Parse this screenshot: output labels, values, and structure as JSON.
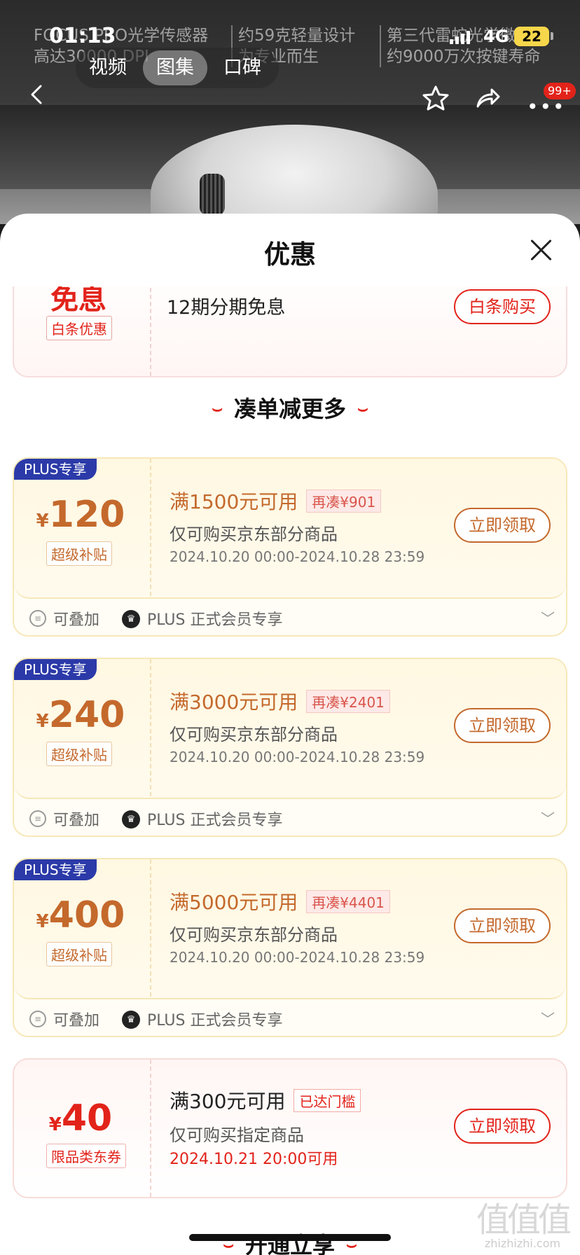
{
  "status_bar": {
    "time": "01:13",
    "network": "4G",
    "battery": "22"
  },
  "background_features": [
    {
      "line1": "FOCUS PRO光学传感器",
      "line2": "高达30000 DPI"
    },
    {
      "line1": "约59克轻量设计",
      "line2": "为专业而生"
    },
    {
      "line1": "第三代雷蛇光学微动",
      "line2": "约9000万次按键寿命"
    }
  ],
  "media_tabs": [
    "视频",
    "图集",
    "口碑"
  ],
  "top_badge": "99+",
  "sheet": {
    "title": "优惠"
  },
  "baitiao": {
    "big_text": "免息",
    "tag": "白条优惠",
    "desc": "12期分期免息",
    "button": "白条购买"
  },
  "section_more": {
    "title": "凑单减更多"
  },
  "coupons": [
    {
      "badge": "PLUS专享",
      "currency": "¥",
      "amount": "120",
      "type": "超级补贴",
      "condition": "满1500元可用",
      "need_more": "再凑¥901",
      "scope": "仅可购买京东部分商品",
      "period": "2024.10.20 00:00-2024.10.28 23:59",
      "button": "立即领取",
      "stack": "可叠加",
      "member": "PLUS 正式会员专享"
    },
    {
      "badge": "PLUS专享",
      "currency": "¥",
      "amount": "240",
      "type": "超级补贴",
      "condition": "满3000元可用",
      "need_more": "再凑¥2401",
      "scope": "仅可购买京东部分商品",
      "period": "2024.10.20 00:00-2024.10.28 23:59",
      "button": "立即领取",
      "stack": "可叠加",
      "member": "PLUS 正式会员专享"
    },
    {
      "badge": "PLUS专享",
      "currency": "¥",
      "amount": "400",
      "type": "超级补贴",
      "condition": "满5000元可用",
      "need_more": "再凑¥4401",
      "scope": "仅可购买京东部分商品",
      "period": "2024.10.20 00:00-2024.10.28 23:59",
      "button": "立即领取",
      "stack": "可叠加",
      "member": "PLUS 正式会员专享"
    }
  ],
  "coupon_jd": {
    "currency": "¥",
    "amount": "40",
    "type": "限品类东券",
    "condition": "满300元可用",
    "status": "已达门槛",
    "scope": "仅可购买指定商品",
    "period": "2024.10.21 20:00可用",
    "button": "立即领取"
  },
  "section_plus": {
    "title": "开通立享"
  },
  "watermark": {
    "main": "值值值",
    "sub": "zhizhizhi.com"
  }
}
